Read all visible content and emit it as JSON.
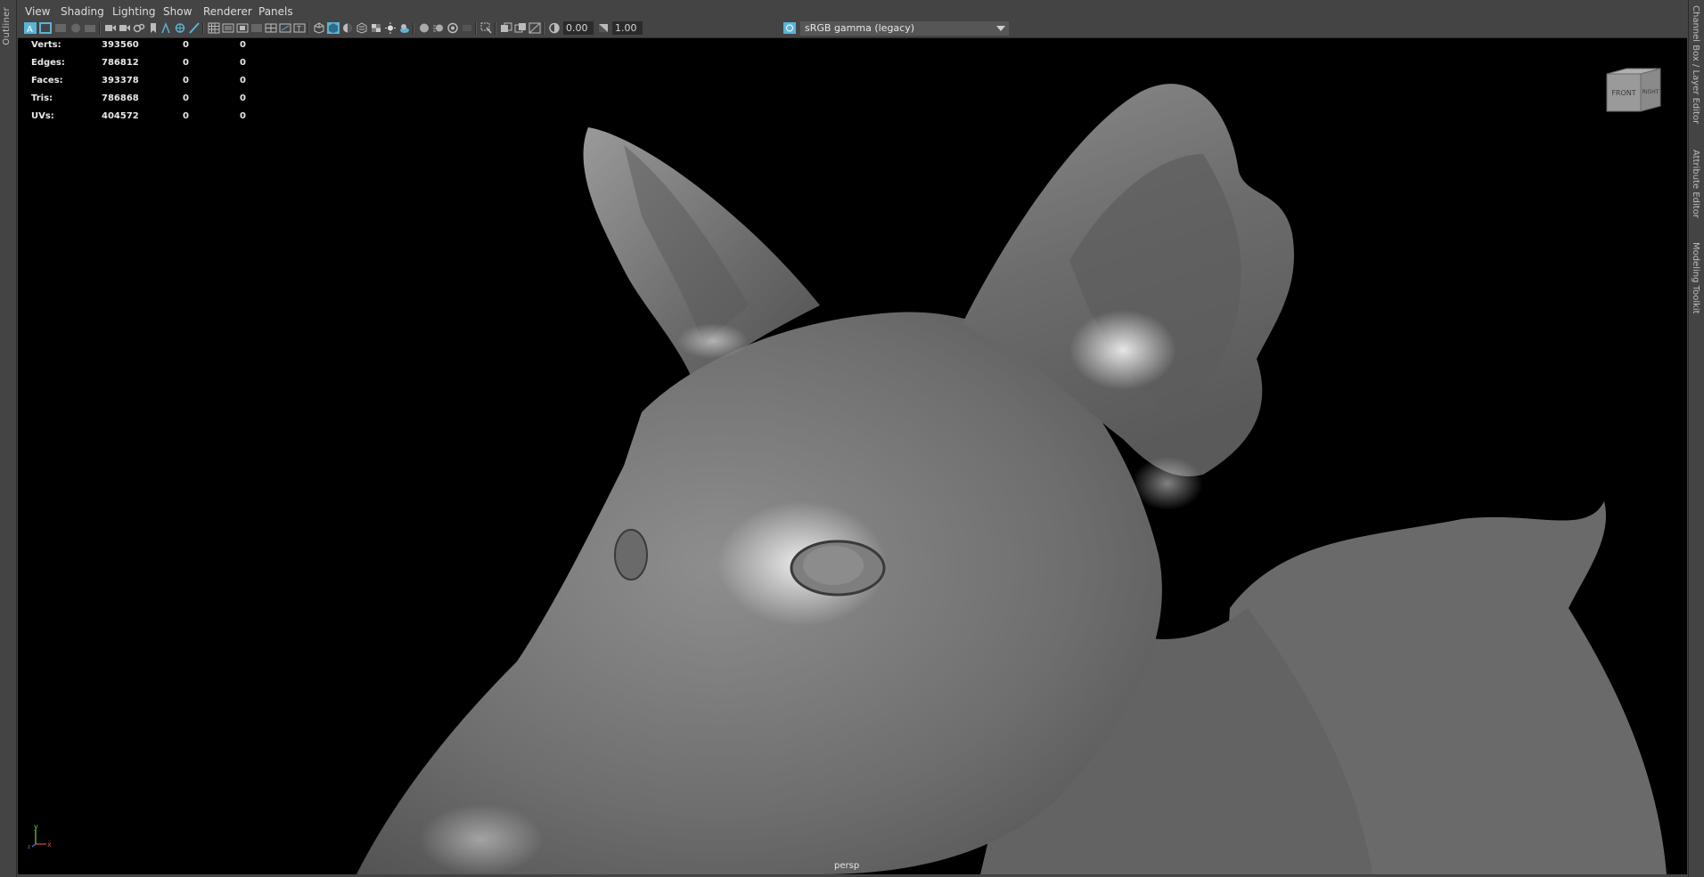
{
  "left_panel": {
    "label": "Outliner"
  },
  "right_panel": {
    "tabs": [
      "Channel Box / Layer Editor",
      "Attribute Editor",
      "Modeling Toolkit"
    ]
  },
  "menubar": {
    "items": [
      "View",
      "Shading",
      "Lighting",
      "Show",
      "Renderer",
      "Panels"
    ]
  },
  "toolbar": {
    "exposure_value": "0.00",
    "gamma_value": "1.00",
    "color_space": "sRGB gamma (legacy)"
  },
  "hud": {
    "rows": [
      {
        "label": "Verts:",
        "value": "393560",
        "selected": "0",
        "uv": "0"
      },
      {
        "label": "Edges:",
        "value": "786812",
        "selected": "0",
        "uv": "0"
      },
      {
        "label": "Faces:",
        "value": "393378",
        "selected": "0",
        "uv": "0"
      },
      {
        "label": "Tris:",
        "value": "786868",
        "selected": "0",
        "uv": "0"
      },
      {
        "label": "UVs:",
        "value": "404572",
        "selected": "0",
        "uv": "0"
      }
    ]
  },
  "viewport": {
    "camera": "persp"
  },
  "viewcube": {
    "front": "FRONT",
    "right": "RIGHT"
  },
  "axis": {
    "y": "y",
    "x": "x",
    "z": "z"
  },
  "colors": {
    "ui_bg": "#444444",
    "viewport_bg": "#000000",
    "accent": "#5ab4d6",
    "axis_x": "#e04848",
    "axis_y": "#7ad34a",
    "axis_z": "#4a78e0"
  }
}
